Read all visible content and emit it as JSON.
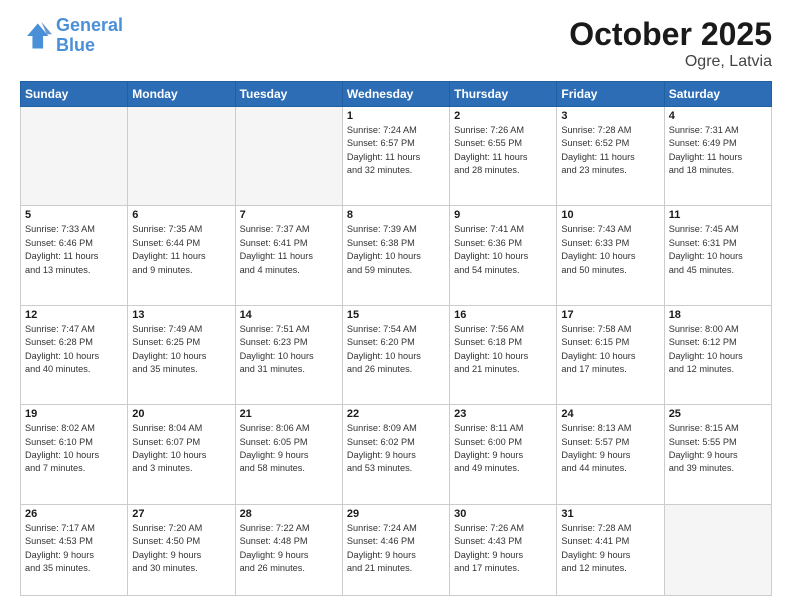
{
  "logo": {
    "line1": "General",
    "line2": "Blue"
  },
  "title": "October 2025",
  "location": "Ogre, Latvia",
  "days_header": [
    "Sunday",
    "Monday",
    "Tuesday",
    "Wednesday",
    "Thursday",
    "Friday",
    "Saturday"
  ],
  "weeks": [
    [
      {
        "day": "",
        "info": ""
      },
      {
        "day": "",
        "info": ""
      },
      {
        "day": "",
        "info": ""
      },
      {
        "day": "1",
        "info": "Sunrise: 7:24 AM\nSunset: 6:57 PM\nDaylight: 11 hours\nand 32 minutes."
      },
      {
        "day": "2",
        "info": "Sunrise: 7:26 AM\nSunset: 6:55 PM\nDaylight: 11 hours\nand 28 minutes."
      },
      {
        "day": "3",
        "info": "Sunrise: 7:28 AM\nSunset: 6:52 PM\nDaylight: 11 hours\nand 23 minutes."
      },
      {
        "day": "4",
        "info": "Sunrise: 7:31 AM\nSunset: 6:49 PM\nDaylight: 11 hours\nand 18 minutes."
      }
    ],
    [
      {
        "day": "5",
        "info": "Sunrise: 7:33 AM\nSunset: 6:46 PM\nDaylight: 11 hours\nand 13 minutes."
      },
      {
        "day": "6",
        "info": "Sunrise: 7:35 AM\nSunset: 6:44 PM\nDaylight: 11 hours\nand 9 minutes."
      },
      {
        "day": "7",
        "info": "Sunrise: 7:37 AM\nSunset: 6:41 PM\nDaylight: 11 hours\nand 4 minutes."
      },
      {
        "day": "8",
        "info": "Sunrise: 7:39 AM\nSunset: 6:38 PM\nDaylight: 10 hours\nand 59 minutes."
      },
      {
        "day": "9",
        "info": "Sunrise: 7:41 AM\nSunset: 6:36 PM\nDaylight: 10 hours\nand 54 minutes."
      },
      {
        "day": "10",
        "info": "Sunrise: 7:43 AM\nSunset: 6:33 PM\nDaylight: 10 hours\nand 50 minutes."
      },
      {
        "day": "11",
        "info": "Sunrise: 7:45 AM\nSunset: 6:31 PM\nDaylight: 10 hours\nand 45 minutes."
      }
    ],
    [
      {
        "day": "12",
        "info": "Sunrise: 7:47 AM\nSunset: 6:28 PM\nDaylight: 10 hours\nand 40 minutes."
      },
      {
        "day": "13",
        "info": "Sunrise: 7:49 AM\nSunset: 6:25 PM\nDaylight: 10 hours\nand 35 minutes."
      },
      {
        "day": "14",
        "info": "Sunrise: 7:51 AM\nSunset: 6:23 PM\nDaylight: 10 hours\nand 31 minutes."
      },
      {
        "day": "15",
        "info": "Sunrise: 7:54 AM\nSunset: 6:20 PM\nDaylight: 10 hours\nand 26 minutes."
      },
      {
        "day": "16",
        "info": "Sunrise: 7:56 AM\nSunset: 6:18 PM\nDaylight: 10 hours\nand 21 minutes."
      },
      {
        "day": "17",
        "info": "Sunrise: 7:58 AM\nSunset: 6:15 PM\nDaylight: 10 hours\nand 17 minutes."
      },
      {
        "day": "18",
        "info": "Sunrise: 8:00 AM\nSunset: 6:12 PM\nDaylight: 10 hours\nand 12 minutes."
      }
    ],
    [
      {
        "day": "19",
        "info": "Sunrise: 8:02 AM\nSunset: 6:10 PM\nDaylight: 10 hours\nand 7 minutes."
      },
      {
        "day": "20",
        "info": "Sunrise: 8:04 AM\nSunset: 6:07 PM\nDaylight: 10 hours\nand 3 minutes."
      },
      {
        "day": "21",
        "info": "Sunrise: 8:06 AM\nSunset: 6:05 PM\nDaylight: 9 hours\nand 58 minutes."
      },
      {
        "day": "22",
        "info": "Sunrise: 8:09 AM\nSunset: 6:02 PM\nDaylight: 9 hours\nand 53 minutes."
      },
      {
        "day": "23",
        "info": "Sunrise: 8:11 AM\nSunset: 6:00 PM\nDaylight: 9 hours\nand 49 minutes."
      },
      {
        "day": "24",
        "info": "Sunrise: 8:13 AM\nSunset: 5:57 PM\nDaylight: 9 hours\nand 44 minutes."
      },
      {
        "day": "25",
        "info": "Sunrise: 8:15 AM\nSunset: 5:55 PM\nDaylight: 9 hours\nand 39 minutes."
      }
    ],
    [
      {
        "day": "26",
        "info": "Sunrise: 7:17 AM\nSunset: 4:53 PM\nDaylight: 9 hours\nand 35 minutes."
      },
      {
        "day": "27",
        "info": "Sunrise: 7:20 AM\nSunset: 4:50 PM\nDaylight: 9 hours\nand 30 minutes."
      },
      {
        "day": "28",
        "info": "Sunrise: 7:22 AM\nSunset: 4:48 PM\nDaylight: 9 hours\nand 26 minutes."
      },
      {
        "day": "29",
        "info": "Sunrise: 7:24 AM\nSunset: 4:46 PM\nDaylight: 9 hours\nand 21 minutes."
      },
      {
        "day": "30",
        "info": "Sunrise: 7:26 AM\nSunset: 4:43 PM\nDaylight: 9 hours\nand 17 minutes."
      },
      {
        "day": "31",
        "info": "Sunrise: 7:28 AM\nSunset: 4:41 PM\nDaylight: 9 hours\nand 12 minutes."
      },
      {
        "day": "",
        "info": ""
      }
    ]
  ]
}
